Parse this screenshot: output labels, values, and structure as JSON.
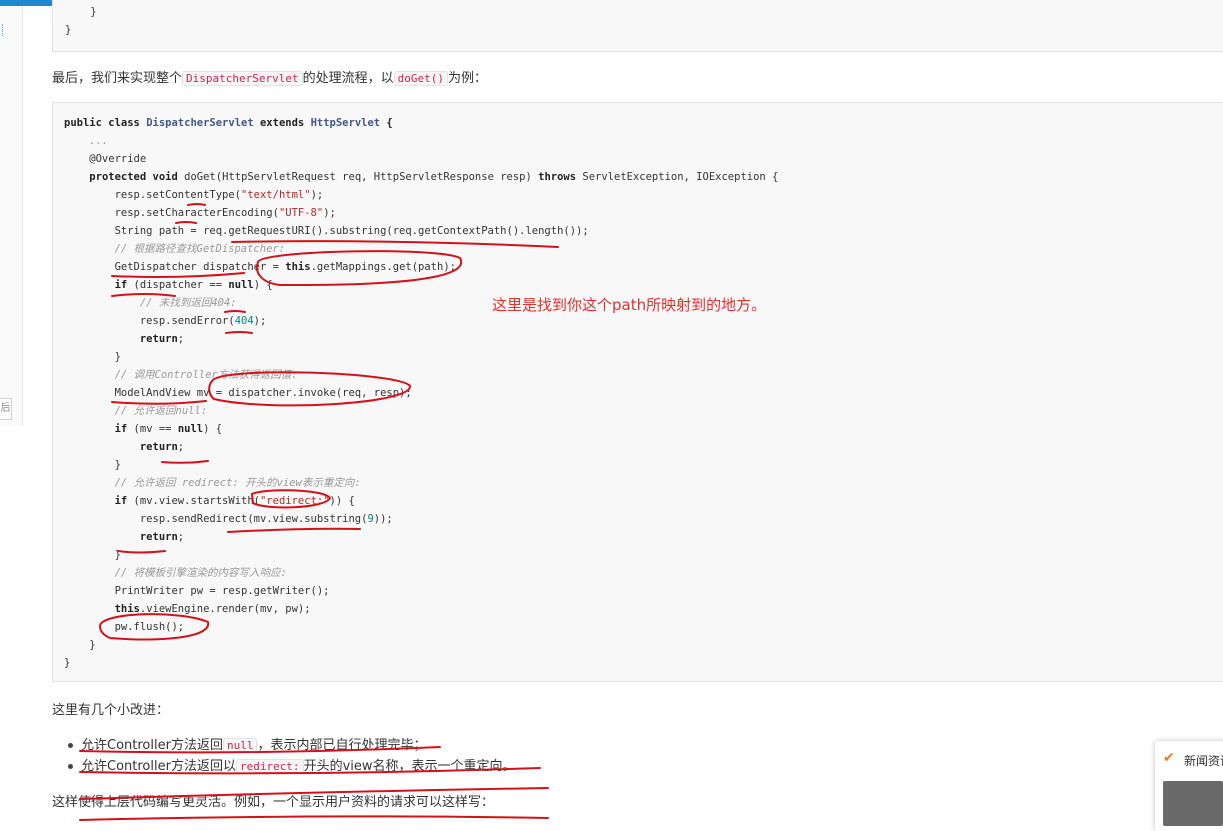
{
  "top_code": {
    "lines": [
      "    }",
      "}"
    ]
  },
  "intro": {
    "prefix": "最后，我们来实现整个",
    "code_a": "DispatcherServlet",
    "middle": "的处理流程，以",
    "code_b": "doGet()",
    "suffix": "为例："
  },
  "code": {
    "l01": {
      "a": "public class ",
      "b": "DispatcherServlet",
      "c": " extends ",
      "d": "HttpServlet",
      "e": " {"
    },
    "l02": "    ...",
    "l03": "    @Override",
    "l04": {
      "a": "    ",
      "b": "protected void",
      "c": " doGet(HttpServletRequest req, HttpServletResponse resp) ",
      "d": "throws",
      "e": " ServletException, IOException {"
    },
    "l05": {
      "a": "        resp.setContentType(",
      "b": "\"text/html\"",
      "c": ");"
    },
    "l06": {
      "a": "        resp.setCharacterEncoding(",
      "b": "\"UTF-8\"",
      "c": ");"
    },
    "l07": "        String path = req.getRequestURI().substring(req.getContextPath().length());",
    "l08": "        // 根据路径查找GetDispatcher:",
    "l09": {
      "a": "        GetDispatcher dispatcher = ",
      "b": "this",
      "c": ".getMappings.get(path);"
    },
    "l10": {
      "a": "        ",
      "b": "if",
      "c": " (dispatcher == ",
      "d": "null",
      "e": ") {"
    },
    "l11": "            // 未找到返回404:",
    "l12": {
      "a": "            resp.sendError(",
      "b": "404",
      "c": ");"
    },
    "l13": {
      "a": "            ",
      "b": "return",
      "c": ";"
    },
    "l14": "        }",
    "l15": "        // 调用Controller方法获得返回值:",
    "l16": "        ModelAndView mv = dispatcher.invoke(req, resp);",
    "l17": "        // 允许返回null:",
    "l18": {
      "a": "        ",
      "b": "if",
      "c": " (mv == ",
      "d": "null",
      "e": ") {"
    },
    "l19": {
      "a": "            ",
      "b": "return",
      "c": ";"
    },
    "l20": "        }",
    "l21": "        // 允许返回 redirect: 开头的view表示重定向:",
    "l22": {
      "a": "        ",
      "b": "if",
      "c": " (mv.view.startsWith(",
      "d": "\"redirect:\"",
      "e": ")) {"
    },
    "l23": {
      "a": "            resp.sendRedirect(mv.view.substring(",
      "b": "9",
      "c": "));"
    },
    "l24": {
      "a": "            ",
      "b": "return",
      "c": ";"
    },
    "l25": "        }",
    "l26": "        // 将模板引擎渲染的内容写入响应:",
    "l27": "        PrintWriter pw = resp.getWriter();",
    "l28": {
      "a": "        ",
      "b": "this",
      "c": ".viewEngine.render(mv, pw);"
    },
    "l29": "        pw.flush();",
    "l30": "    }",
    "l31": "}"
  },
  "annotation": "这里是找到你这个path所映射到的地方。",
  "improvements_heading": "这里有几个小改进：",
  "bullets": {
    "b1": {
      "prefix": "允许Controller方法返回",
      "code": "null",
      "suffix": "，表示内部已自行处理完毕；"
    },
    "b2": {
      "prefix": "允许Controller方法返回以",
      "code": "redirect:",
      "suffix": "开头的view名称，表示一个重定向。"
    }
  },
  "closing": "这样使得上层代码编写更灵活。例如，一个显示用户资料的请求可以这样写：",
  "side_card": {
    "label": "新闻资讯",
    "logo_icon": "v-logo-icon"
  },
  "colors": {
    "topbar": "#1b8ad3",
    "annotation": "#e0312e",
    "ink": "#d4111a"
  }
}
